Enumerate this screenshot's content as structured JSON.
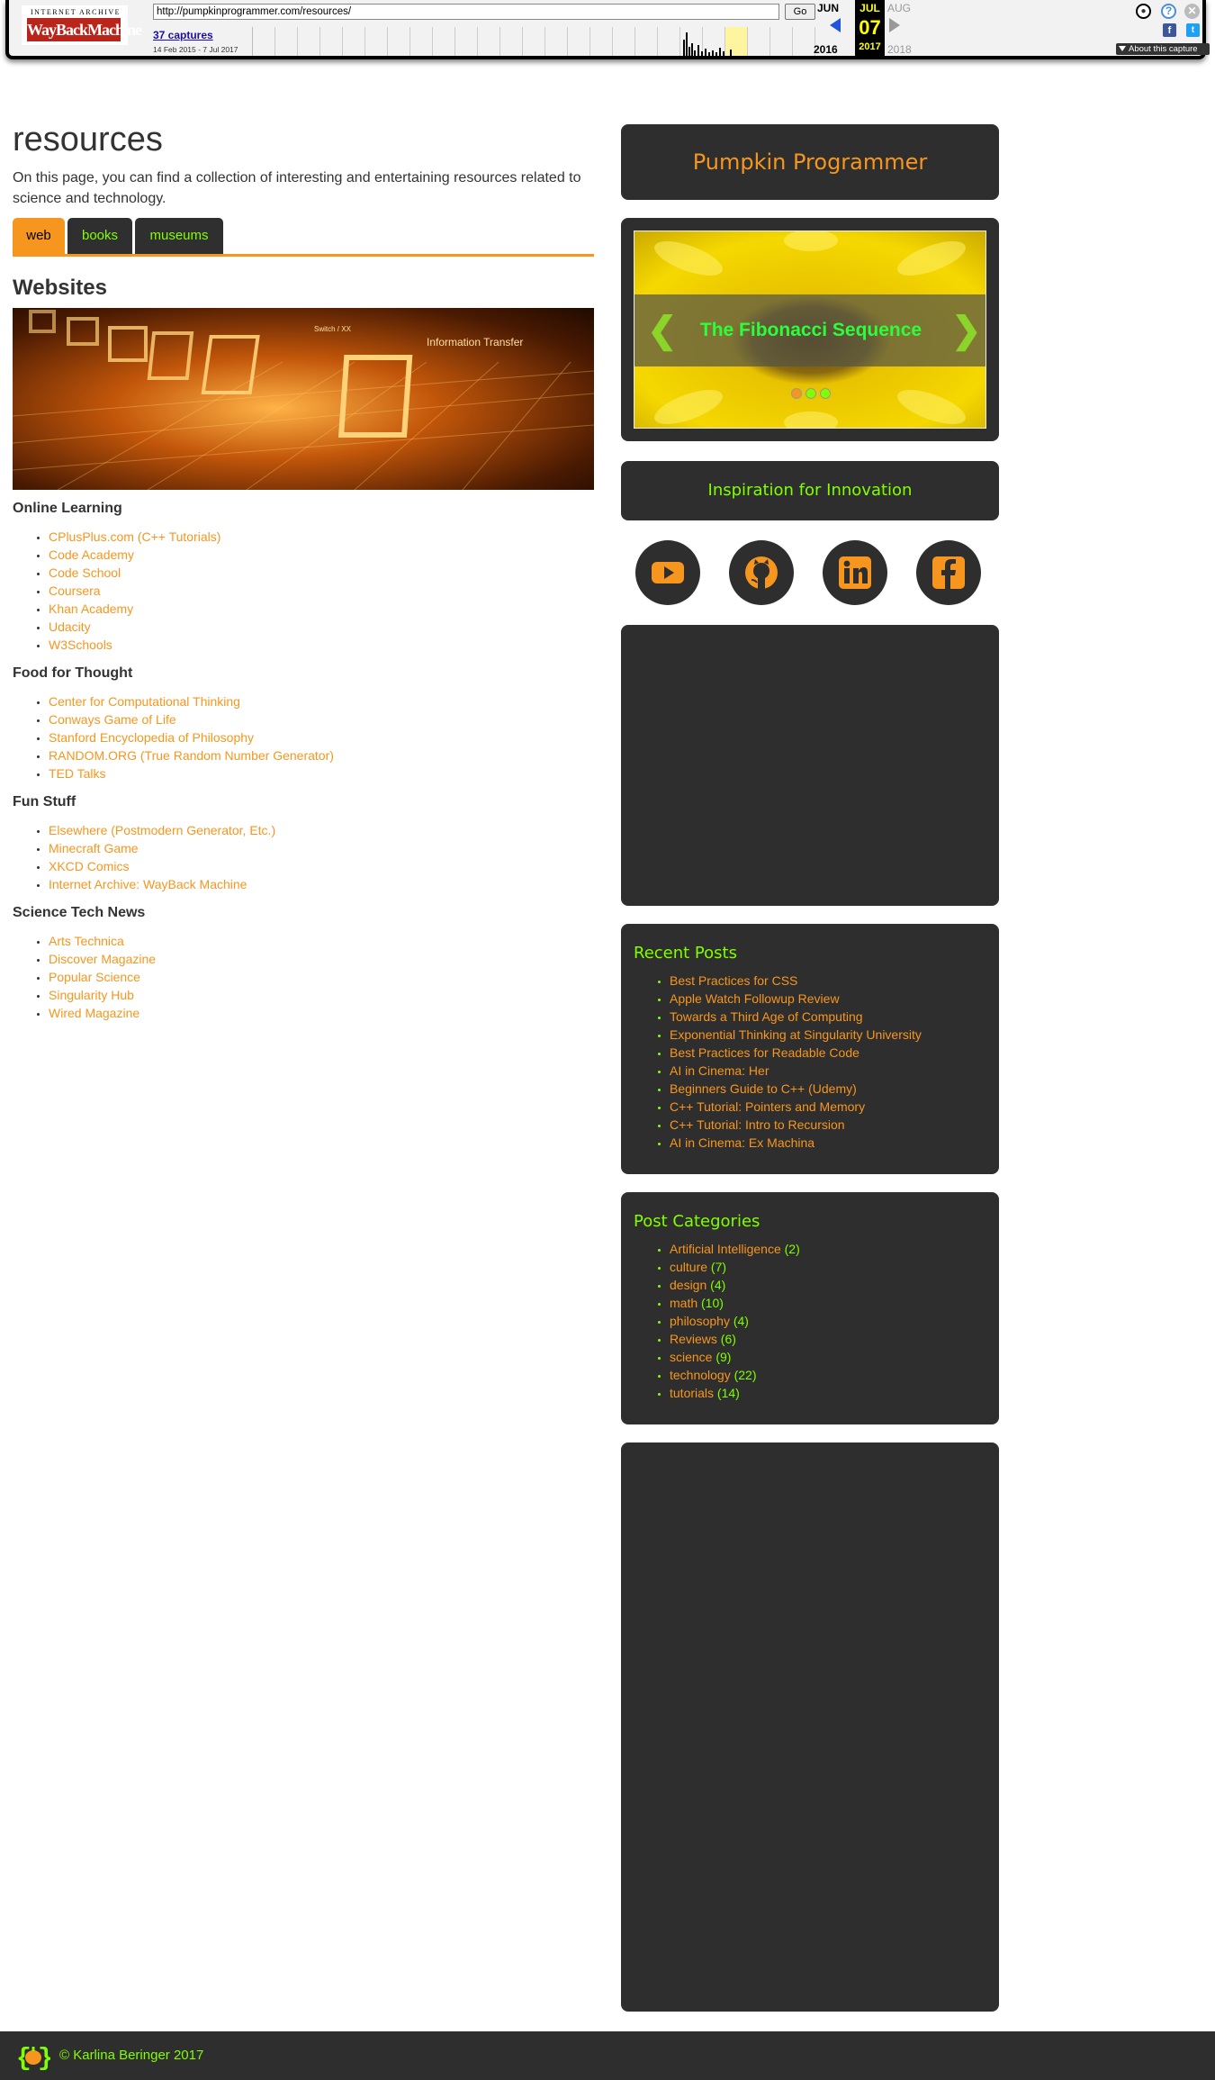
{
  "wayback": {
    "logo_top": "INTERNET ARCHIVE",
    "logo_main": "WayBackMachine",
    "url": "http://pumpkinprogrammer.com/resources/",
    "go_label": "Go",
    "captures": "37 captures",
    "range": "14 Feb 2015 - 7 Jul 2017",
    "prev_month": "JUN",
    "cur_month": "JUL",
    "next_month": "AUG",
    "cur_day": "07",
    "prev_year": "2016",
    "cur_year": "2017",
    "next_year": "2018",
    "about": "About this capture"
  },
  "main": {
    "title": "resources",
    "intro": "On this page, you can find a collection of interesting and entertaining resources related to science and technology.",
    "tabs": [
      {
        "label": "web",
        "active": true
      },
      {
        "label": "books",
        "active": false
      },
      {
        "label": "museums",
        "active": false
      }
    ],
    "section_title": "Websites",
    "banner_text": [
      "Information Transfer",
      "Switch / XX"
    ],
    "groups": [
      {
        "title": "Online Learning",
        "links": [
          "CPlusPlus.com (C++ Tutorials)",
          "Code Academy",
          "Code School",
          "Coursera",
          "Khan Academy",
          "Udacity",
          "W3Schools"
        ]
      },
      {
        "title": "Food for Thought",
        "links": [
          "Center for Computational Thinking",
          "Conways Game of Life",
          "Stanford Encyclopedia of Philosophy",
          "RANDOM.ORG (True Random Number Generator)",
          "TED Talks"
        ]
      },
      {
        "title": "Fun Stuff",
        "links": [
          "Elsewhere (Postmodern Generator, Etc.)",
          "Minecraft Game",
          "XKCD Comics",
          "Internet Archive: WayBack Machine"
        ]
      },
      {
        "title": "Science Tech News",
        "links": [
          "Arts Technica",
          "Discover Magazine",
          "Popular Science",
          "Singularity Hub",
          "Wired Magazine"
        ]
      }
    ]
  },
  "sidebar": {
    "brand": "Pumpkin Programmer",
    "slide_caption": "The Fibonacci Sequence",
    "inspiration": "Inspiration for Innovation",
    "social": [
      "youtube-icon",
      "github-icon",
      "linkedin-icon",
      "facebook-icon"
    ],
    "recent_title": "Recent Posts",
    "recent_posts": [
      "Best Practices for CSS",
      "Apple Watch Followup Review",
      "Towards a Third Age of Computing",
      "Exponential Thinking at Singularity University",
      "Best Practices for Readable Code",
      "AI in Cinema: Her",
      "Beginners Guide to C++ (Udemy)",
      "C++ Tutorial: Pointers and Memory",
      "C++ Tutorial: Intro to Recursion",
      "AI in Cinema: Ex Machina"
    ],
    "categories_title": "Post Categories",
    "categories": [
      {
        "name": "Artificial Intelligence",
        "count": "(2)"
      },
      {
        "name": "culture",
        "count": "(7)"
      },
      {
        "name": "design",
        "count": "(4)"
      },
      {
        "name": "math",
        "count": "(10)"
      },
      {
        "name": "philosophy",
        "count": "(4)"
      },
      {
        "name": "Reviews",
        "count": "(6)"
      },
      {
        "name": "science",
        "count": "(9)"
      },
      {
        "name": "technology",
        "count": "(22)"
      },
      {
        "name": "tutorials",
        "count": "(14)"
      }
    ]
  },
  "footer": {
    "text": "© Karlina Beringer 2017"
  },
  "colors": {
    "accent_orange": "#f7961e",
    "accent_green": "#7fff00",
    "panel_dark": "#2e2e2e"
  }
}
